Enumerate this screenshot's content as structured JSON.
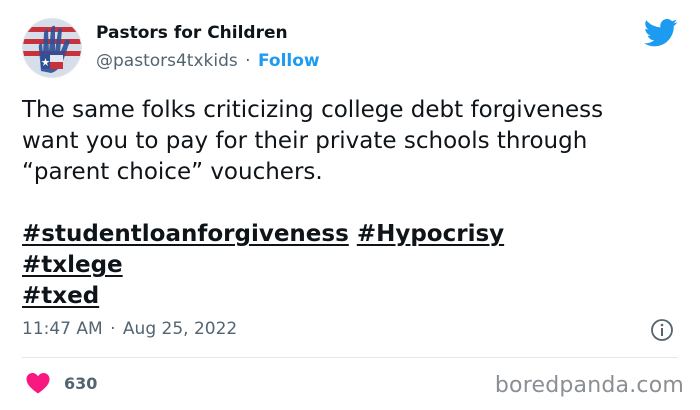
{
  "author": {
    "display_name": "Pastors for Children",
    "handle": "@pastors4txkids",
    "separator": "·",
    "follow_label": "Follow"
  },
  "tweet": {
    "lines": [
      "The same folks criticizing college debt forgiveness",
      "want you to pay for their private schools through",
      "“parent choice” vouchers."
    ],
    "hashtags": [
      "#studentloanforgiveness",
      "#Hypocrisy",
      "#txlege",
      "#txed"
    ]
  },
  "meta": {
    "time": "11:47 AM",
    "separator": "·",
    "date": "Aug 25, 2022"
  },
  "engagement": {
    "likes": "630"
  },
  "watermark": "boredpanda.com",
  "colors": {
    "twitter_blue": "#1d9bf0",
    "heart_pink": "#f91880",
    "text_primary": "#0f1419",
    "text_secondary": "#536471"
  },
  "icons": [
    "avatar-hand-flag",
    "twitter-bird-icon",
    "info-icon",
    "heart-icon"
  ]
}
